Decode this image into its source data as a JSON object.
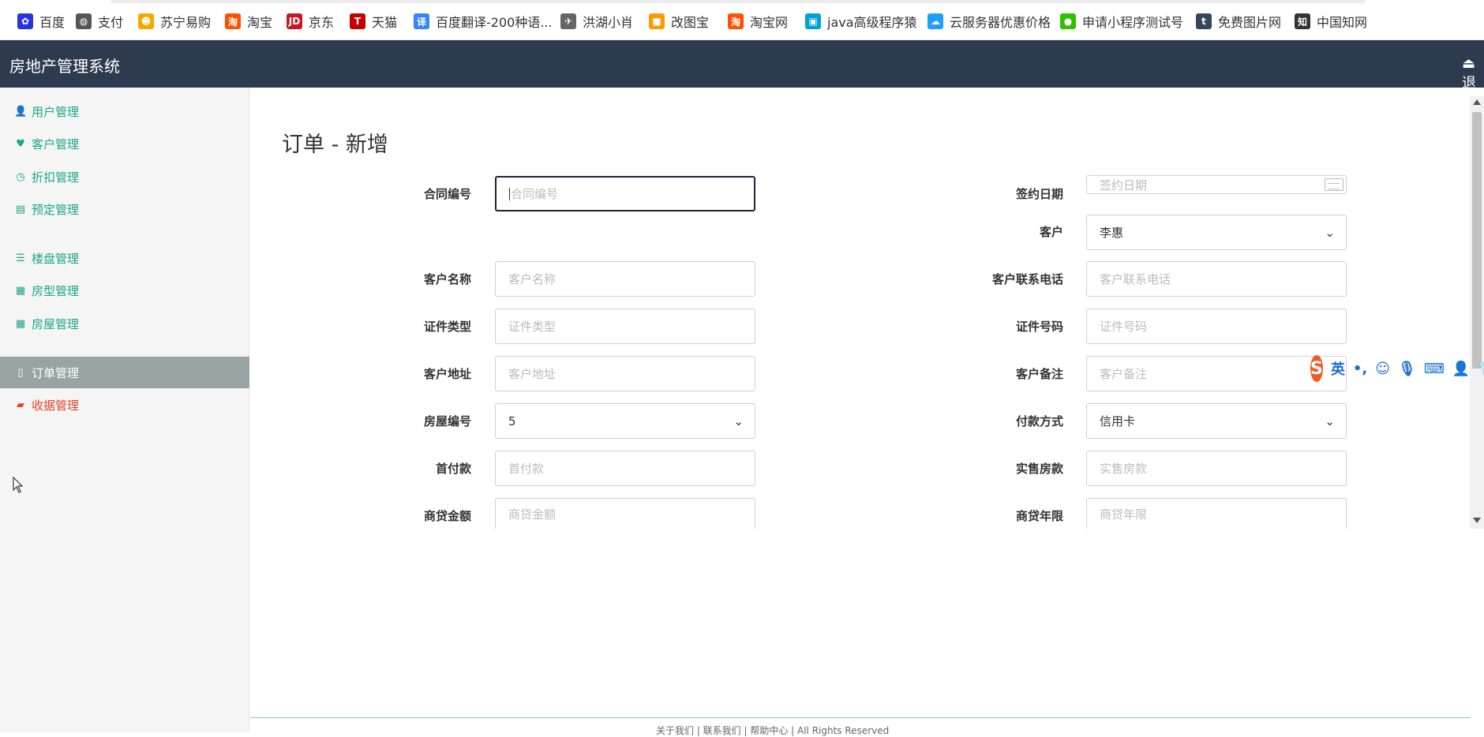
{
  "bookmarks": [
    {
      "label": "百度",
      "icon": "baidu-icon",
      "color": "#2932e1",
      "glyph": "✿"
    },
    {
      "label": "支付",
      "icon": "globe-icon",
      "color": "#555555",
      "glyph": "◍"
    },
    {
      "label": "苏宁易购",
      "icon": "suning-icon",
      "color": "#f7a800",
      "glyph": "☻"
    },
    {
      "label": "淘宝",
      "icon": "taobao-icon",
      "color": "#ff5000",
      "glyph": "淘"
    },
    {
      "label": "京东",
      "icon": "jd-icon",
      "color": "#c81623",
      "glyph": "JD"
    },
    {
      "label": "天猫",
      "icon": "tmall-icon",
      "color": "#c40000",
      "glyph": "T"
    },
    {
      "label": "百度翻译-200种语...",
      "icon": "translate-icon",
      "color": "#3385ff",
      "glyph": "译"
    },
    {
      "label": "洪湖小肖",
      "icon": "bird-icon",
      "color": "#666666",
      "glyph": "✈"
    },
    {
      "label": "改图宝",
      "icon": "gaitubao-icon",
      "color": "#ff9a00",
      "glyph": "■"
    },
    {
      "label": "淘宝网",
      "icon": "taobao-net-icon",
      "color": "#ff5000",
      "glyph": "淘"
    },
    {
      "label": "java高级程序猿",
      "icon": "bilibili-icon",
      "color": "#00a1d6",
      "glyph": "▣"
    },
    {
      "label": "云服务器优惠价格",
      "icon": "cloud-icon",
      "color": "#1e9fff",
      "glyph": "☁"
    },
    {
      "label": "申请小程序测试号",
      "icon": "wechat-icon",
      "color": "#2dc100",
      "glyph": "●"
    },
    {
      "label": "免费图片网",
      "icon": "tumblr-icon",
      "color": "#36465d",
      "glyph": "t"
    },
    {
      "label": "中国知网",
      "icon": "cnki-icon",
      "color": "#333333",
      "glyph": "知"
    }
  ],
  "header": {
    "brand": "房地产管理系统",
    "logout_icon": "sign-out-icon",
    "logout_label": "退"
  },
  "sidebar": {
    "items": [
      {
        "label": "用户管理",
        "icon": "user-icon",
        "glyph": "👤"
      },
      {
        "label": "客户管理",
        "icon": "heart-icon",
        "glyph": "♥"
      },
      {
        "label": "折扣管理",
        "icon": "clock-icon",
        "glyph": "◷"
      },
      {
        "label": "预定管理",
        "icon": "list-alt-icon",
        "glyph": "▤"
      },
      {
        "label": "楼盘管理",
        "icon": "list-icon",
        "glyph": "☰"
      },
      {
        "label": "房型管理",
        "icon": "th-large-icon",
        "glyph": "▦"
      },
      {
        "label": "房屋管理",
        "icon": "th-icon",
        "glyph": "▦"
      },
      {
        "label": "订单管理",
        "icon": "file-icon",
        "glyph": "▯"
      },
      {
        "label": "收据管理",
        "icon": "folder-open-icon",
        "glyph": "▰"
      }
    ]
  },
  "form": {
    "title": "订单 - 新增",
    "contract_no": {
      "label": "合同编号",
      "placeholder": "合同编号"
    },
    "sign_date": {
      "label": "签约日期",
      "placeholder": "签约日期"
    },
    "customer": {
      "label": "客户",
      "value": "李惠"
    },
    "customer_name": {
      "label": "客户名称",
      "placeholder": "客户名称"
    },
    "customer_phone": {
      "label": "客户联系电话",
      "placeholder": "客户联系电话"
    },
    "id_type": {
      "label": "证件类型",
      "placeholder": "证件类型"
    },
    "id_number": {
      "label": "证件号码",
      "placeholder": "证件号码"
    },
    "address": {
      "label": "客户地址",
      "placeholder": "客户地址"
    },
    "remark": {
      "label": "客户备注",
      "placeholder": "客户备注"
    },
    "house_no": {
      "label": "房屋编号",
      "value": "5"
    },
    "payment": {
      "label": "付款方式",
      "value": "信用卡"
    },
    "down_payment": {
      "label": "首付款",
      "placeholder": "首付款"
    },
    "actual_price": {
      "label": "实售房款",
      "placeholder": "实售房款"
    },
    "loan_amount": {
      "label": "商贷金额",
      "placeholder": "商贷金额"
    },
    "loan_years": {
      "label": "商贷年限",
      "placeholder": "商贷年限"
    }
  },
  "ime": {
    "lang": "英",
    "punct": "•,",
    "icons": [
      "smile-icon",
      "mic-icon",
      "keyboard-icon",
      "user-icon",
      "shirt-icon"
    ]
  },
  "footer": {
    "text": "关于我们 | 联系我们 | 帮助中心 | All Rights Reserved"
  }
}
